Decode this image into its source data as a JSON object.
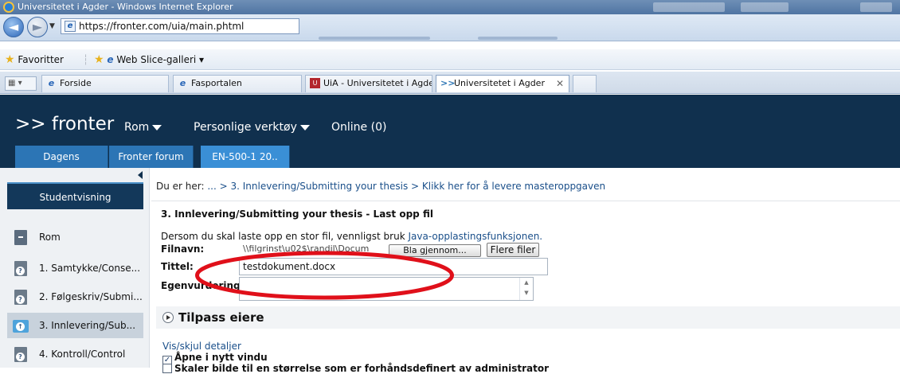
{
  "browser": {
    "window_title": "Universitetet i Agder - Windows Internet Explorer",
    "url": "https://fronter.com/uia/main.phtml",
    "favorites_label": "Favoritter",
    "web_slice_label": "Web Slice-galleri ▾",
    "tabs": [
      {
        "label": "Forside",
        "icon": "ie-page-icon"
      },
      {
        "label": "Fasportalen",
        "icon": "ie-page-icon"
      },
      {
        "label": "UiA - Universitetet i Agder",
        "icon": "uia-site-icon"
      },
      {
        "label": "Universitetet i Agder",
        "icon": "fronter-icon",
        "active": true
      }
    ],
    "tab_close": "✕"
  },
  "fronter": {
    "logo": ">> fronter",
    "menu": [
      {
        "label": "Rom",
        "dropdown": true
      },
      {
        "label": "Personlige verktøy",
        "dropdown": true
      },
      {
        "label": "Online (0)",
        "dropdown": false
      }
    ],
    "course_tabs": [
      {
        "label": "Dagens"
      },
      {
        "label": "Fronter forum"
      },
      {
        "label": "EN-500-1 20..",
        "active": true
      }
    ]
  },
  "sidebar": {
    "student_view": "Studentvisning",
    "items": [
      {
        "label": "Rom",
        "icon": "room-icon"
      },
      {
        "label": "1. Samtykke/Conse...",
        "icon": "document-help-icon"
      },
      {
        "label": "2. Følgeskriv/Submi...",
        "icon": "document-help-icon"
      },
      {
        "label": "3. Innlevering/Sub...",
        "icon": "folder-icon",
        "active": true
      },
      {
        "label": "4. Kontroll/Control",
        "icon": "document-help-icon"
      }
    ]
  },
  "main": {
    "breadcrumb_prefix": "Du er her:",
    "breadcrumb_trail": " ... > 3. Innlevering/Submitting your thesis > Klikk her for å levere masteroppgaven",
    "heading": "3. Innlevering/Submitting your thesis - Last opp fil",
    "info_text": "Dersom du skal laste opp en stor fil, vennligst bruk ",
    "info_link": "Java-opplastingsfunksjonen.",
    "form": {
      "filename_label": "Filnavn:",
      "filename_value": "\\\\filgrinst\\u02$\\randil\\Docum",
      "browse_label": "Bla gjennom...",
      "more_files_label": "Flere filer",
      "title_label": "Tittel:",
      "title_value": "testdokument.docx",
      "self_eval_label": "Egenvurdering:"
    },
    "tilpass_label": "Tilpass eiere",
    "show_hide_link": "Vis/skjul detaljer",
    "checkboxes": [
      {
        "label": "Åpne i nytt vindu",
        "checked": true
      },
      {
        "label": "Skaler bilde til en størrelse som er forhåndsdefinert av administrator",
        "checked": false
      }
    ]
  },
  "colors": {
    "header_bg": "#10304e",
    "tab_blue": "#2c75b5",
    "link": "#1a4f8a",
    "highlight_ellipse": "#e0101a"
  }
}
